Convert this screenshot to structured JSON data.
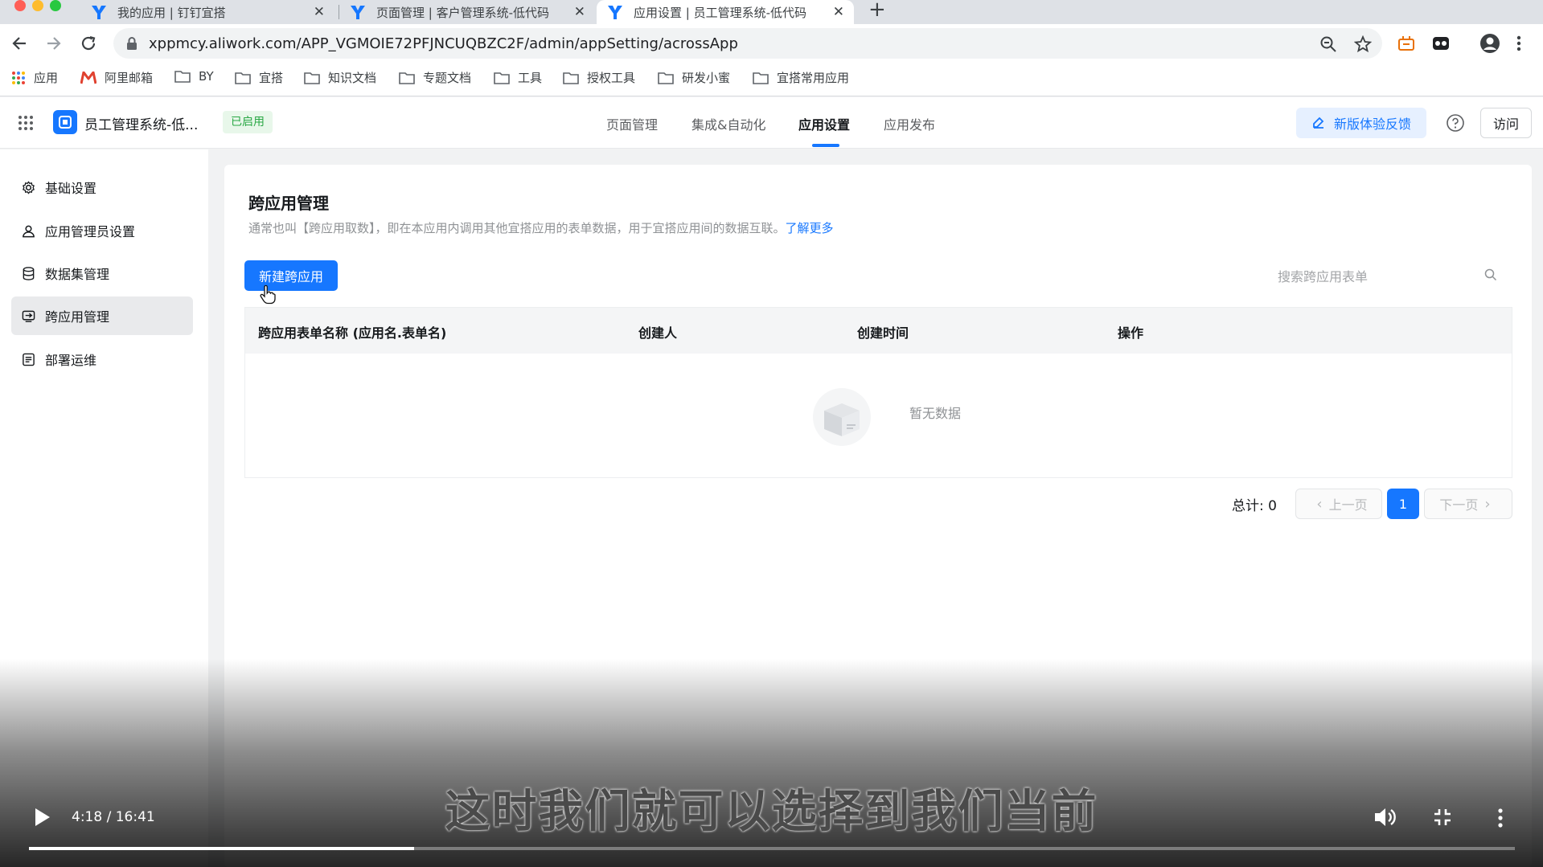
{
  "browser": {
    "tabs": [
      {
        "title": "我的应用 | 钉钉宜搭"
      },
      {
        "title": "页面管理 | 客户管理系统-低代码"
      },
      {
        "title": "应用设置 | 员工管理系统-低代码"
      }
    ],
    "url": "xppmcy.aliwork.com/APP_VGMOIE72PFJNCUQBZC2F/admin/appSetting/acrossApp",
    "bookmarks": [
      "应用",
      "阿里邮箱",
      "BY",
      "宜搭",
      "知识文档",
      "专题文档",
      "工具",
      "授权工具",
      "研发小蜜",
      "宜搭常用应用"
    ]
  },
  "header": {
    "app_name": "员工管理系统-低...",
    "status_badge": "已启用",
    "nav": [
      "页面管理",
      "集成&自动化",
      "应用设置",
      "应用发布"
    ],
    "active_nav": "应用设置",
    "feedback_label": "新版体验反馈",
    "visit_label": "访问"
  },
  "sidebar": {
    "items": [
      {
        "label": "基础设置",
        "icon": "gear-icon"
      },
      {
        "label": "应用管理员设置",
        "icon": "user-icon"
      },
      {
        "label": "数据集管理",
        "icon": "database-icon"
      },
      {
        "label": "跨应用管理",
        "icon": "cross-app-icon"
      },
      {
        "label": "部署运维",
        "icon": "deploy-icon"
      }
    ],
    "active": "跨应用管理"
  },
  "main": {
    "title": "跨应用管理",
    "description": "通常也叫【跨应用取数】，即在本应用内调用其他宜搭应用的表单数据，用于宜搭应用间的数据互联。",
    "learn_more": "了解更多",
    "new_button": "新建跨应用",
    "search_placeholder": "搜索跨应用表单",
    "table": {
      "columns": [
        "跨应用表单名称 (应用名.表单名)",
        "创建人",
        "创建时间",
        "操作"
      ],
      "rows": [],
      "empty_text": "暂无数据"
    },
    "pagination": {
      "total_label": "总计: 0",
      "prev_label": "上一页",
      "next_label": "下一页",
      "current_page": "1"
    }
  },
  "video": {
    "subtitle": "这时我们就可以选择到我们当前",
    "time": "4:18 / 16:41",
    "progress": 0.2594
  },
  "colors": {
    "primary": "#1677ff",
    "success_badge_bg": "#e8f7ea",
    "success_badge_text": "#2aa845"
  }
}
